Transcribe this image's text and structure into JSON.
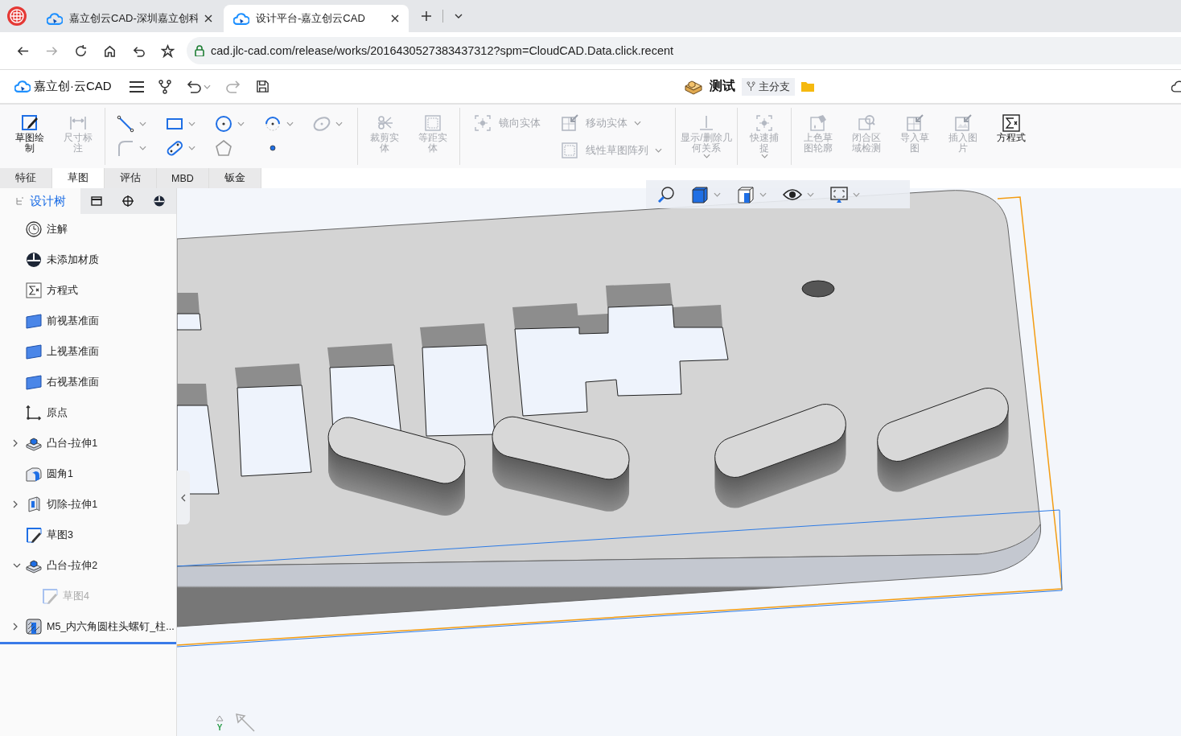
{
  "browser": {
    "tabs": [
      {
        "title": "嘉立创云CAD-深圳嘉立创科",
        "selected": false
      },
      {
        "title": "设计平台-嘉立创云CAD",
        "selected": true
      }
    ],
    "url": "cad.jlc-cad.com/release/works/2016430527383437312?spm=CloudCAD.Data.click.recent"
  },
  "app_header": {
    "logo_text": "嘉立创·云CAD",
    "document_title": "测试",
    "branch": "主分支"
  },
  "ribbon": {
    "groups": [
      {
        "kind": "large",
        "items": [
          {
            "kind": "sketch",
            "label": "草图绘制",
            "disabled": false,
            "dropdown": false
          },
          {
            "kind": "dimension",
            "label": "尺寸标注",
            "disabled": true,
            "dropdown": false
          }
        ]
      },
      {
        "kind": "grid",
        "items": [
          {
            "kind": "line",
            "disabled": false,
            "dropdown": true
          },
          {
            "kind": "rectangle",
            "disabled": false,
            "dropdown": true
          },
          {
            "kind": "circle",
            "disabled": false,
            "dropdown": true
          },
          {
            "kind": "arc",
            "disabled": false,
            "dropdown": true
          },
          {
            "kind": "ellipse",
            "disabled": true,
            "dropdown": true
          },
          {
            "kind": "corner",
            "disabled": true,
            "dropdown": true
          },
          {
            "kind": "slot",
            "disabled": false,
            "dropdown": true
          },
          {
            "kind": "polygon",
            "disabled": true,
            "dropdown": false
          },
          {
            "kind": "point",
            "disabled": false,
            "dropdown": false
          }
        ]
      },
      {
        "kind": "large",
        "items": [
          {
            "kind": "trim",
            "label": "裁剪实体",
            "disabled": true,
            "dropdown": false
          },
          {
            "kind": "offset",
            "label": "等距实体",
            "disabled": true,
            "dropdown": false
          }
        ]
      },
      {
        "kind": "inline",
        "items": [
          {
            "kind": "mirror",
            "label": "镜向实体",
            "disabled": true,
            "dropdown": false
          },
          {
            "kind": "move",
            "label": "移动实体",
            "disabled": true,
            "dropdown": true
          },
          {
            "kind": "pattern",
            "label": "线性草图阵列",
            "disabled": true,
            "dropdown": true
          }
        ]
      },
      {
        "kind": "large",
        "items": [
          {
            "kind": "relation",
            "label": "显示/删除几何关系",
            "disabled": true,
            "dropdown": true
          }
        ]
      },
      {
        "kind": "large",
        "items": [
          {
            "kind": "snap",
            "label": "快速捕捉",
            "disabled": true,
            "dropdown": true
          }
        ]
      },
      {
        "kind": "large",
        "items": [
          {
            "kind": "shade",
            "label": "上色草图轮廓",
            "disabled": true,
            "dropdown": false
          },
          {
            "kind": "region",
            "label": "闭合区域检测",
            "disabled": true,
            "dropdown": false
          },
          {
            "kind": "import",
            "label": "导入草图",
            "disabled": true,
            "dropdown": false
          },
          {
            "kind": "picture",
            "label": "插入图片",
            "disabled": true,
            "dropdown": false
          },
          {
            "kind": "equation",
            "label": "方程式",
            "disabled": false,
            "dropdown": false
          }
        ]
      }
    ]
  },
  "ribbon_tabs": [
    {
      "label": "特征",
      "selected": false
    },
    {
      "label": "草图",
      "selected": true
    },
    {
      "label": "评估",
      "selected": false
    },
    {
      "label": "MBD",
      "selected": false
    },
    {
      "label": "钣金",
      "selected": false
    }
  ],
  "panel_tabs": [
    {
      "kind": "tree",
      "label": "设计树",
      "selected": true
    },
    {
      "kind": "layers",
      "selected": false
    },
    {
      "kind": "target",
      "selected": false
    },
    {
      "kind": "material",
      "selected": false
    }
  ],
  "tree": {
    "items": [
      {
        "kind": "annotation",
        "label": "注解",
        "disabled": false
      },
      {
        "kind": "material",
        "label": "未添加材质",
        "disabled": false
      },
      {
        "kind": "equation",
        "label": "方程式",
        "disabled": false
      },
      {
        "kind": "plane",
        "label": "前视基准面",
        "disabled": false
      },
      {
        "kind": "plane",
        "label": "上视基准面",
        "disabled": false
      },
      {
        "kind": "plane",
        "label": "右视基准面",
        "disabled": false
      },
      {
        "kind": "origin",
        "label": "原点",
        "disabled": false
      },
      {
        "kind": "boss",
        "label": "凸台-拉伸1",
        "expanded": false,
        "disabled": false
      },
      {
        "kind": "fillet",
        "label": "圆角1",
        "disabled": false
      },
      {
        "kind": "cut",
        "label": "切除-拉伸1",
        "expanded": false,
        "disabled": false
      },
      {
        "kind": "sketch",
        "label": "草图3",
        "disabled": false
      },
      {
        "kind": "boss",
        "label": "凸台-拉伸2",
        "expanded": true,
        "disabled": false,
        "children": [
          {
            "kind": "sketch",
            "label": "草图4",
            "disabled": true
          }
        ]
      },
      {
        "kind": "part",
        "label": "M5_内六角圆柱头螺钉_柱...",
        "expanded": false,
        "disabled": false
      }
    ]
  },
  "viewport": {
    "triad_label": "Y"
  }
}
